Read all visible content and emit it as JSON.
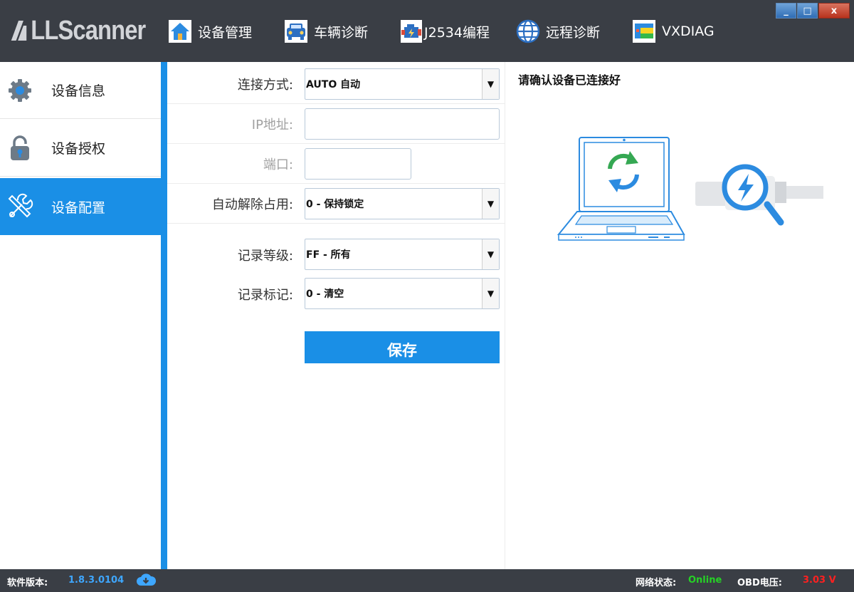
{
  "app": {
    "logo_text": "LLScanner"
  },
  "nav": [
    {
      "label": "设备管理",
      "icon": "home-icon"
    },
    {
      "label": "车辆诊断",
      "icon": "car-icon"
    },
    {
      "label": "J2534编程",
      "icon": "engine-icon"
    },
    {
      "label": "远程诊断",
      "icon": "globe-icon"
    },
    {
      "label": "VXDIAG",
      "icon": "vxdiag-icon"
    }
  ],
  "window_buttons": {
    "minimize": "_",
    "maximize": "□",
    "close": "x"
  },
  "sidebar": {
    "items": [
      {
        "label": "设备信息",
        "icon": "gear-icon",
        "active": false
      },
      {
        "label": "设备授权",
        "icon": "lock-icon",
        "active": false
      },
      {
        "label": "设备配置",
        "icon": "tools-icon",
        "active": true
      }
    ]
  },
  "form": {
    "connection": {
      "label": "连接方式:",
      "value": "AUTO 自动"
    },
    "ip": {
      "label": "IP地址:",
      "value": ""
    },
    "port": {
      "label": "端口:",
      "value": ""
    },
    "auto_release": {
      "label": "自动解除占用:",
      "value": "0 - 保持锁定"
    },
    "log_level": {
      "label": "记录等级:",
      "value": "FF - 所有"
    },
    "log_mark": {
      "label": "记录标记:",
      "value": "0 - 清空"
    },
    "save_label": "保存",
    "arrow": "▼"
  },
  "right_panel": {
    "title": "请确认设备已连接好"
  },
  "status_bar": {
    "version_label": "软件版本:",
    "version_value": "1.8.3.0104",
    "network_label": "网络状态:",
    "network_value": "Online",
    "obd_label": "OBD电压:",
    "obd_value": "3.03 V"
  },
  "colors": {
    "accent": "#1a8fe6",
    "topbar": "#3a3e45",
    "online": "#26d126",
    "voltage": "#ff2020"
  }
}
